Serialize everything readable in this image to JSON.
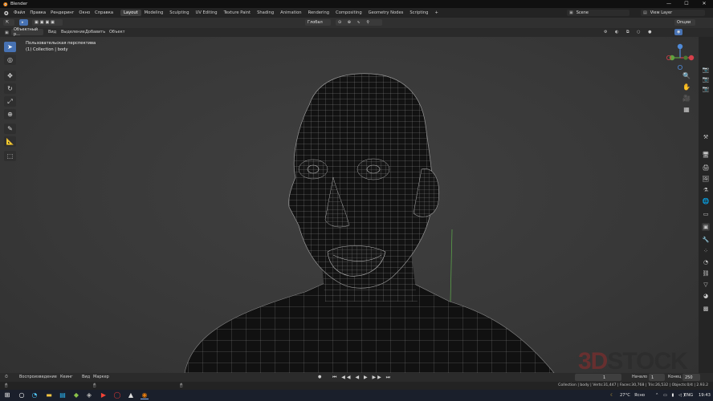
{
  "window": {
    "title": "Blender",
    "controls": [
      "—",
      "☐",
      "✕"
    ]
  },
  "menu": [
    "Файл",
    "Правка",
    "Рендеринг",
    "Окно",
    "Справка"
  ],
  "workspaces": [
    {
      "label": "Layout",
      "active": true
    },
    {
      "label": "Modeling"
    },
    {
      "label": "Sculpting"
    },
    {
      "label": "UV Editing"
    },
    {
      "label": "Texture Paint"
    },
    {
      "label": "Shading"
    },
    {
      "label": "Animation"
    },
    {
      "label": "Rendering"
    },
    {
      "label": "Compositing"
    },
    {
      "label": "Geometry Nodes"
    },
    {
      "label": "Scripting"
    }
  ],
  "add_workspace": "+",
  "scene": {
    "label": "Scene",
    "view_layer": "View Layer"
  },
  "header": {
    "mode": "Объектный р...",
    "menus": [
      "Вид",
      "Выделение",
      "Добавить",
      "Объект"
    ],
    "transform": "Глобал",
    "options": "Опции"
  },
  "viewport": {
    "view_name": "Пользовательская перспектива",
    "collection": "(1) Collection | body"
  },
  "timeline": {
    "menus": [
      "Воспроизведение",
      "Кеинг",
      "Вид",
      "Маркер"
    ],
    "current_frame": "1",
    "start_label": "Начало",
    "start": "1",
    "end_label": "Конец",
    "end": "250"
  },
  "status": {
    "stats": "Collection | body | Verts:31,447 | Faces:30,768 | Tris:26,532 | Objects:0/4 | 2.93.2"
  },
  "taskbar": {
    "temperature": "27°C",
    "weather": "Ясно",
    "lang": "ENG",
    "time": "19:43"
  },
  "watermark": {
    "part1": "3D",
    "part2": "STOCK"
  },
  "colors": {
    "accent": "#4772b3",
    "active_tab": "#3d3d3d"
  }
}
